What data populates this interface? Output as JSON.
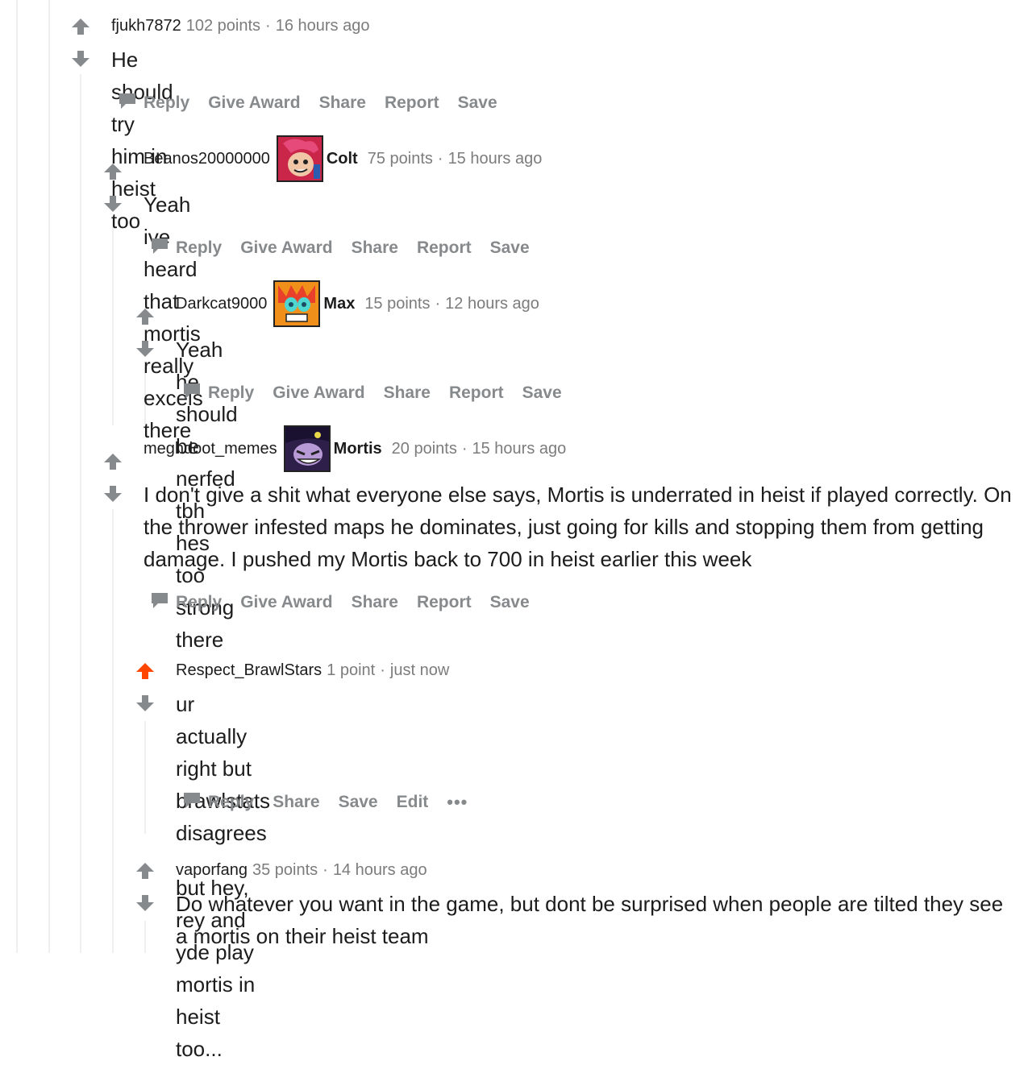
{
  "colors": {
    "upvoted": "#ff4500",
    "neutral_arrow": "#878a8c",
    "meta": "#7c7c7c",
    "thread_line": "#edeff1"
  },
  "comments": [
    {
      "author": "fjukh7872",
      "flair": "",
      "points": "102 points",
      "sep": "·",
      "time": "16 hours ago",
      "body": [
        "He should try him in heist too"
      ],
      "actions": [
        "Reply",
        "Give Award",
        "Share",
        "Report",
        "Save"
      ]
    },
    {
      "author": "Beanos20000000",
      "flair": "Colt",
      "flair_icon": "colt-avatar-icon",
      "points": "75 points",
      "sep": "·",
      "time": "15 hours ago",
      "body": [
        "Yeah ive heard that mortis really excels there"
      ],
      "actions": [
        "Reply",
        "Give Award",
        "Share",
        "Report",
        "Save"
      ]
    },
    {
      "author": "Darkcat9000",
      "flair": "Max",
      "flair_icon": "max-avatar-icon",
      "points": "15 points",
      "sep": "·",
      "time": "12 hours ago",
      "body": [
        "Yeah he should be nerfed tbh hes too strong there"
      ],
      "actions": [
        "Reply",
        "Give Award",
        "Share",
        "Report",
        "Save"
      ]
    },
    {
      "author": "meghdoot_memes",
      "flair": "Mortis",
      "flair_icon": "mortis-avatar-icon",
      "points": "20 points",
      "sep": "·",
      "time": "15 hours ago",
      "body": [
        "I don't give a shit what everyone else says, Mortis is underrated in heist if played correctly. On the thrower infested maps he dominates, just going for kills and stopping them from getting damage. I pushed my Mortis back to 700 in heist earlier this week"
      ],
      "actions": [
        "Reply",
        "Give Award",
        "Share",
        "Report",
        "Save"
      ]
    },
    {
      "author": "Respect_BrawlStars",
      "flair": "",
      "points": "1 point",
      "sep": "·",
      "time": "just now",
      "upvoted": true,
      "body": [
        "ur actually right but brawlstats disagrees",
        "but hey, rey and yde play mortis in heist too..."
      ],
      "actions": [
        "Reply",
        "Share",
        "Save",
        "Edit",
        "•••"
      ]
    },
    {
      "author": "vaporfang",
      "flair": "",
      "points": "35 points",
      "sep": "·",
      "time": "14 hours ago",
      "body": [
        "Do whatever you want in the game, but dont be surprised when people are tilted they see a mortis on their heist team"
      ],
      "actions": []
    }
  ]
}
